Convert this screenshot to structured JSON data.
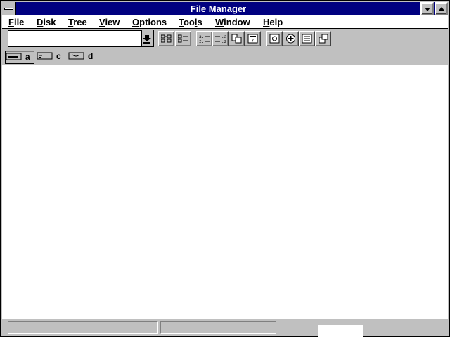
{
  "window": {
    "title": "File Manager"
  },
  "menu": {
    "file": "File",
    "disk": "Disk",
    "tree": "Tree",
    "view": "View",
    "options": "Options",
    "tools_pre": "Too",
    "tools_ul": "l",
    "tools_post": "s",
    "window": "Window",
    "help": "Help"
  },
  "toolbar": {
    "drive_combo_value": "",
    "icons": [
      "connect-network-drive-icon",
      "disconnect-network-drive-icon",
      "sort-by-name-icon",
      "sort-by-type-icon",
      "sort-by-size-icon",
      "sort-by-date-icon",
      "share-as-icon",
      "stop-sharing-icon",
      "view-details-icon",
      "new-window-icon"
    ]
  },
  "drives": [
    {
      "letter": "a",
      "icon": "floppy-drive-icon",
      "selected": true
    },
    {
      "letter": "c",
      "icon": "hard-drive-icon",
      "selected": false
    },
    {
      "letter": "d",
      "icon": "cdrom-drive-icon",
      "selected": false
    }
  ],
  "status": {
    "left": "",
    "right": ""
  }
}
